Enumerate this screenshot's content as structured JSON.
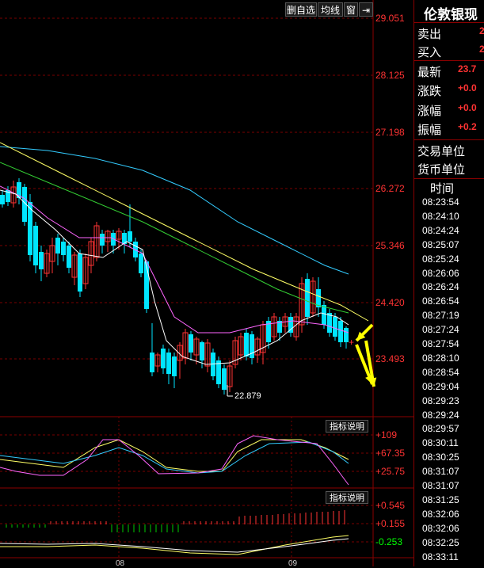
{
  "toolbar": {
    "delete_watch": "删自选",
    "ma_line": "均线",
    "window": "窗",
    "expand": "⇥"
  },
  "price_axis": [
    "29.051",
    "28.125",
    "27.198",
    "26.272",
    "25.346",
    "24.420",
    "23.493"
  ],
  "low_marker": "22.879",
  "indicator1": {
    "button": "指标说明",
    "levels": [
      "+109",
      "+67.35",
      "+25.75"
    ]
  },
  "indicator2": {
    "button": "指标说明",
    "levels": [
      "+0.545",
      "+0.155",
      "-0.253"
    ]
  },
  "x_axis_labels": [
    "08",
    "09"
  ],
  "right_panel": {
    "title": "伦敦银现",
    "quotes": [
      {
        "label": "卖出",
        "value": "2"
      },
      {
        "label": "买入",
        "value": "2"
      },
      {
        "label": "最新",
        "value": "23.7"
      },
      {
        "label": "涨跌",
        "value": "+0.0"
      },
      {
        "label": "涨幅",
        "value": "+0.0"
      },
      {
        "label": "振幅",
        "value": "+0.2"
      }
    ],
    "info": [
      "交易单位",
      "货币单位"
    ],
    "time_header": "时间",
    "times": [
      "08:23:54",
      "08:24:10",
      "08:24:24",
      "08:25:07",
      "08:25:24",
      "08:26:06",
      "08:26:24",
      "08:26:54",
      "08:27:19",
      "08:27:24",
      "08:27:54",
      "08:28:10",
      "08:28:54",
      "08:29:04",
      "08:29:23",
      "08:29:24",
      "08:29:57",
      "08:30:11",
      "08:30:25",
      "08:31:07",
      "08:31:07",
      "08:31:25",
      "08:32:06",
      "08:32:06",
      "08:32:25",
      "08:33:11"
    ]
  },
  "colors": {
    "up": "#ff3333",
    "down": "#00e5ff",
    "ma_white": "#ffffff",
    "ma_yellow": "#ffff66",
    "ma_magenta": "#ff66ff",
    "ma_green": "#33cc33",
    "ma_cyan": "#33ccff",
    "arrow": "#ffff00"
  }
}
